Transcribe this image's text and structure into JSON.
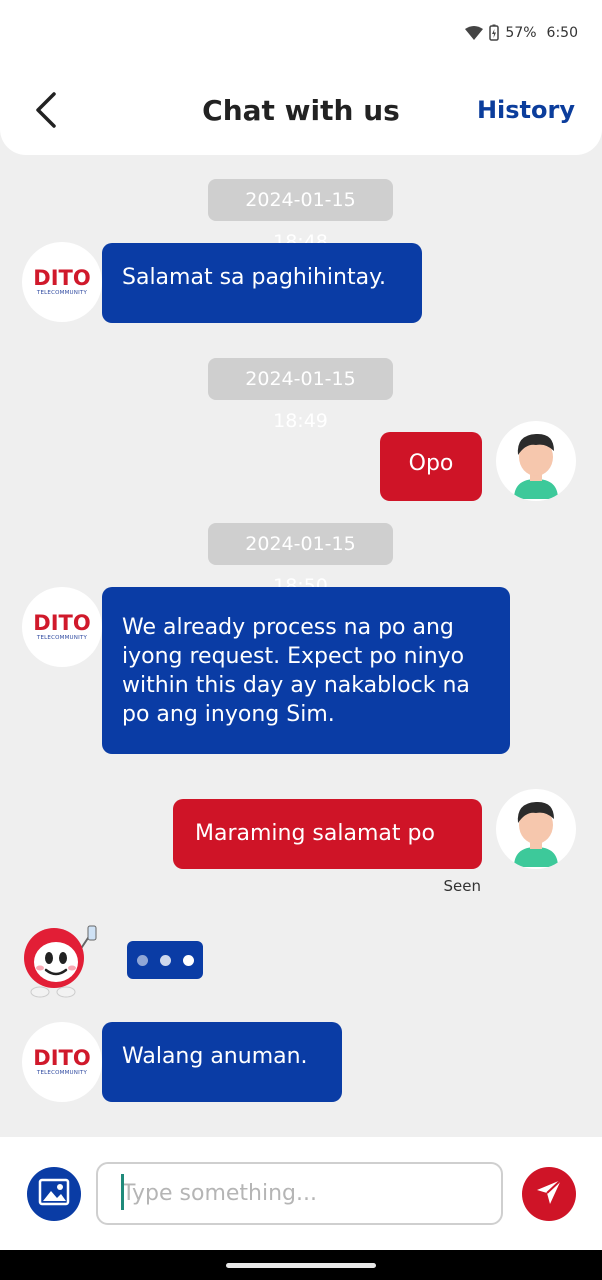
{
  "status_bar": {
    "battery": "57%",
    "time": "6:50",
    "icons": [
      "wifi-icon",
      "battery-icon"
    ]
  },
  "header": {
    "title": "Chat with us",
    "history_label": "History",
    "back_icon": "back-arrow-icon"
  },
  "colors": {
    "agent_bubble": "#0a3ca5",
    "user_bubble": "#cf1427",
    "timestamp_bg": "#cfcfcf",
    "background": "#efefef",
    "brand_red": "#d0192b",
    "brand_blue": "#0b3d9c"
  },
  "chat": {
    "timestamps": [
      "2024-01-15 18:48",
      "2024-01-15 18:49",
      "2024-01-15 18:50"
    ],
    "messages": [
      {
        "sender": "agent",
        "text": "Salamat sa paghihintay."
      },
      {
        "sender": "user",
        "text": "Opo"
      },
      {
        "sender": "agent",
        "text": "We already process na po ang iyong request. Expect po ninyo within this day ay nakablock na po ang inyong Sim."
      },
      {
        "sender": "user",
        "text": "Maraming salamat po"
      },
      {
        "sender": "agent",
        "text": "Walang anuman."
      }
    ],
    "seen_label": "Seen",
    "agent_logo": {
      "word": "DITO",
      "sub": "TELECOMMUNITY"
    }
  },
  "composer": {
    "placeholder": "Type something...",
    "value": "",
    "image_icon": "image-icon",
    "send_icon": "send-icon"
  }
}
